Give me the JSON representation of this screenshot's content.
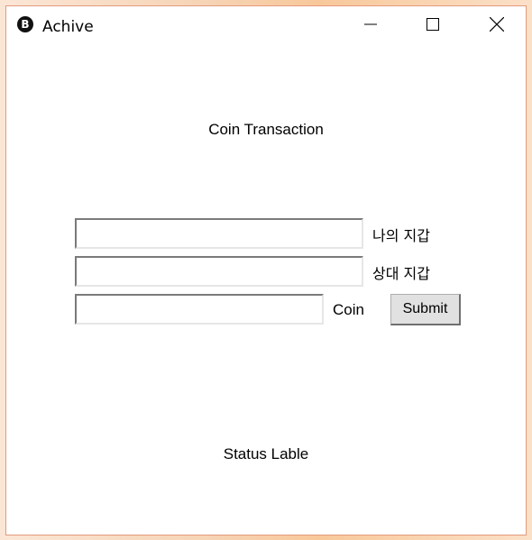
{
  "window": {
    "title": "Achive",
    "icon": "bitcoin-icon",
    "border_color": "#e49a7c"
  },
  "main": {
    "heading": "Coin Transaction",
    "my_wallet_label": "나의 지갑",
    "other_wallet_label": "상대 지갑",
    "coin_label": "Coin",
    "submit_label": "Submit",
    "status_label": "Status Lable",
    "inputs": {
      "my_wallet_value": "",
      "other_wallet_value": "",
      "coin_value": ""
    }
  }
}
